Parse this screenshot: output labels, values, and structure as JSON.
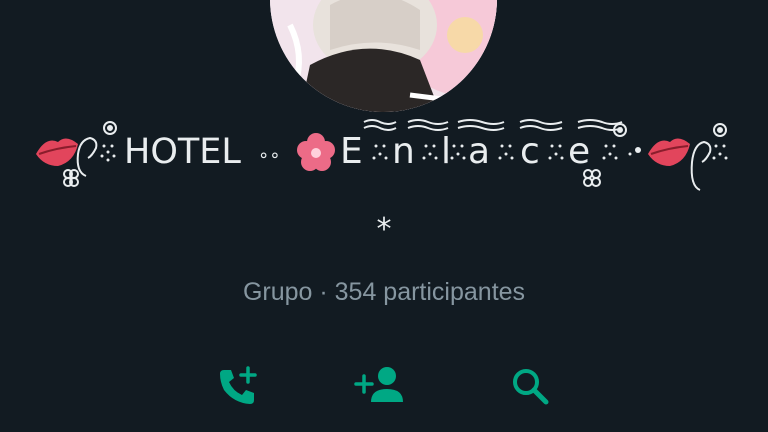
{
  "group": {
    "title_prefix": "HOTEL",
    "title_dots": "∘∘",
    "title_enlace": [
      "E",
      "n",
      "l",
      "a",
      "c",
      "e"
    ],
    "description": "*",
    "meta": "Grupo · 354 participantes"
  },
  "actions": {
    "call_icon": "add-call-icon",
    "add_icon": "add-participant-icon",
    "search_icon": "search-icon"
  },
  "colors": {
    "background": "#121b22",
    "primary_text": "#e9edef",
    "secondary_text": "#8696a0",
    "accent": "#00a884",
    "lips": "#e2455c",
    "flower": "#ec6b87"
  }
}
